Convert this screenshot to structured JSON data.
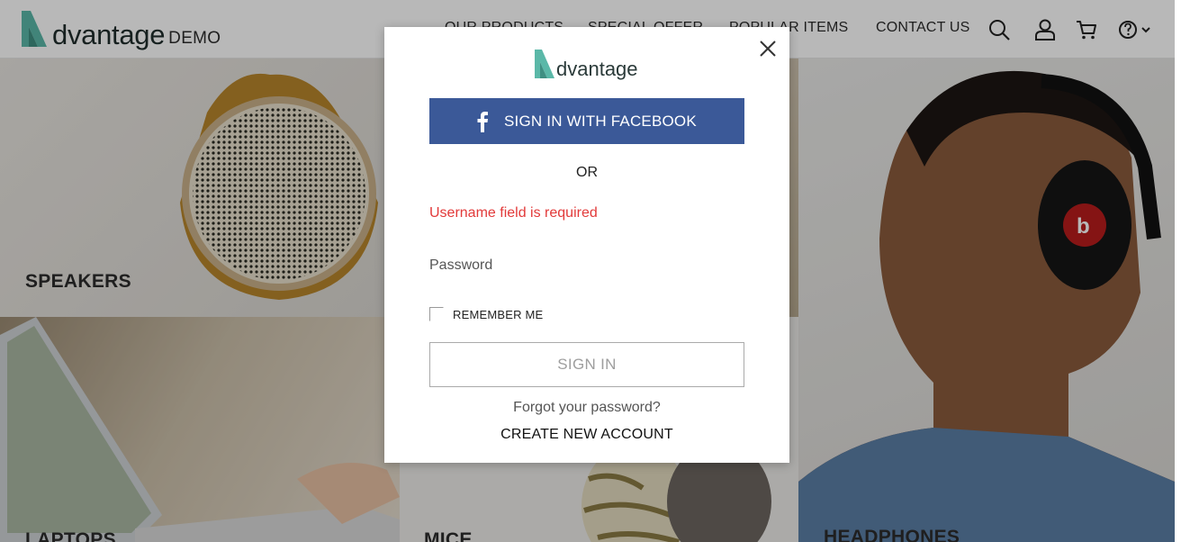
{
  "header": {
    "logo_word": "dvantage",
    "logo_suffix": "DEMO",
    "nav": [
      "OUR PRODUCTS",
      "SPECIAL OFFER",
      "POPULAR ITEMS",
      "CONTACT US"
    ],
    "icons": [
      "search-icon",
      "user-icon",
      "cart-icon",
      "help-icon",
      "chevron-down-icon"
    ]
  },
  "categories": {
    "speakers": "SPEAKERS",
    "laptops": "LAPTOPS",
    "mice": "MICE",
    "headphones": "HEADPHONES"
  },
  "login_modal": {
    "logo_word": "dvantage",
    "facebook_button": "SIGN IN WITH FACEBOOK",
    "or_text": "OR",
    "username_error": "Username field is required",
    "password_placeholder": "Password",
    "remember_me": "REMEMBER ME",
    "sign_in_button": "SIGN IN",
    "forgot_password": "Forgot your password?",
    "create_account": "CREATE NEW ACCOUNT"
  },
  "colors": {
    "brand_teal": "#5bb8a8",
    "facebook_blue": "#3b5998",
    "error_red": "#e23a3a"
  }
}
